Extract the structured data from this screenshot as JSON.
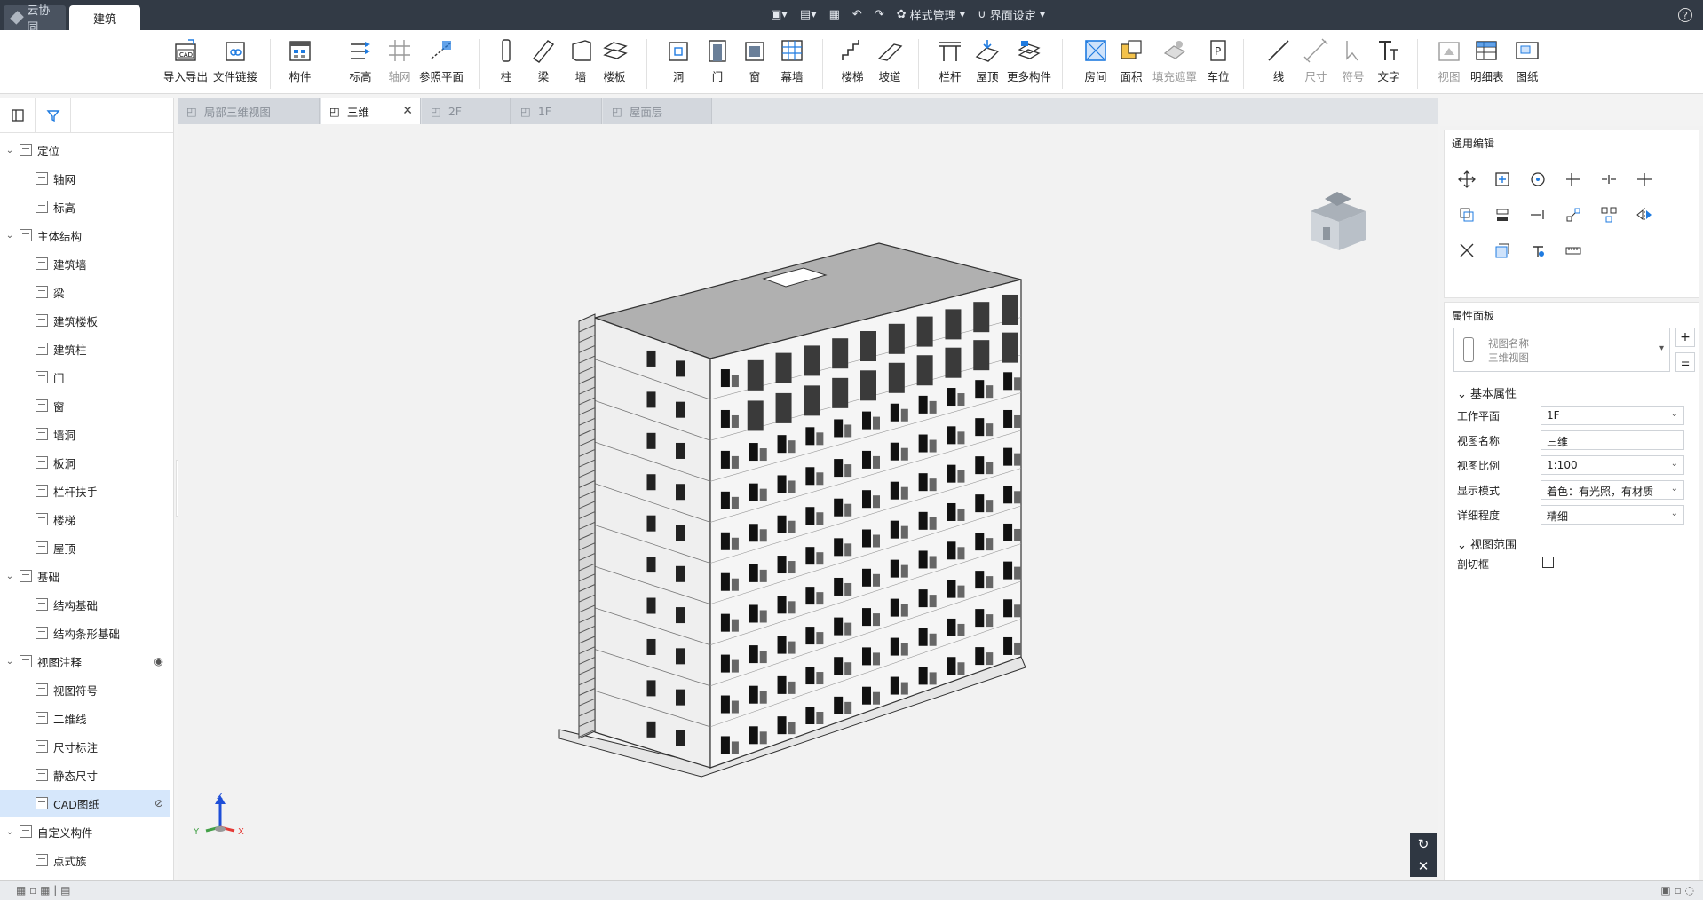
{
  "titlebar": {
    "app_tabs": [
      "云协同",
      "建筑"
    ],
    "quick_access": {
      "style_manage": "样式管理",
      "ui_settings": "界面设定"
    },
    "help": "?"
  },
  "ribbon": {
    "import_export": "导入导出",
    "file_link": "文件链接",
    "component": "构件",
    "level": "标高",
    "grid": "轴网",
    "ref_plane": "参照平面",
    "column": "柱",
    "beam": "梁",
    "wall": "墙",
    "slab": "楼板",
    "hole": "洞",
    "door": "门",
    "window": "窗",
    "curtain_wall": "幕墙",
    "stair": "楼梯",
    "ramp": "坡道",
    "railing": "栏杆",
    "roof": "屋顶",
    "more_components": "更多构件",
    "room": "房间",
    "area": "面积",
    "fill_mask": "填充遮罩",
    "parking": "车位",
    "line": "线",
    "dimension": "尺寸",
    "symbol": "符号",
    "text": "文字",
    "view": "视图",
    "schedule": "明细表",
    "drawing": "图纸",
    "cad_badge": "CAD"
  },
  "tree": [
    {
      "label": "定位",
      "level": 0
    },
    {
      "label": "轴网",
      "level": 1
    },
    {
      "label": "标高",
      "level": 1
    },
    {
      "label": "主体结构",
      "level": 0
    },
    {
      "label": "建筑墙",
      "level": 1
    },
    {
      "label": "梁",
      "level": 1
    },
    {
      "label": "建筑楼板",
      "level": 1
    },
    {
      "label": "建筑柱",
      "level": 1
    },
    {
      "label": "门",
      "level": 1
    },
    {
      "label": "窗",
      "level": 1
    },
    {
      "label": "墙洞",
      "level": 1
    },
    {
      "label": "板洞",
      "level": 1
    },
    {
      "label": "栏杆扶手",
      "level": 1
    },
    {
      "label": "楼梯",
      "level": 1
    },
    {
      "label": "屋顶",
      "level": 1
    },
    {
      "label": "基础",
      "level": 0
    },
    {
      "label": "结构基础",
      "level": 1
    },
    {
      "label": "结构条形基础",
      "level": 1
    },
    {
      "label": "视图注释",
      "level": 0
    },
    {
      "label": "视图符号",
      "level": 1
    },
    {
      "label": "二维线",
      "level": 1
    },
    {
      "label": "尺寸标注",
      "level": 1
    },
    {
      "label": "静态尺寸",
      "level": 1
    },
    {
      "label": "CAD图纸",
      "level": 1
    },
    {
      "label": "自定义构件",
      "level": 0
    },
    {
      "label": "点式族",
      "level": 1
    }
  ],
  "doc_tabs": [
    "局部三维视图",
    "三维",
    "2F",
    "1F",
    "屋面层"
  ],
  "right_panel": {
    "general_edit": "通用编辑",
    "property_panel": "属性面板",
    "view_name_caption": "视图名称",
    "view_name_value": "三维视图",
    "basic_props": "基本属性",
    "props": [
      {
        "label": "工作平面",
        "value": "1F"
      },
      {
        "label": "视图名称",
        "value": "三维"
      },
      {
        "label": "视图比例",
        "value": "1:100"
      },
      {
        "label": "显示模式",
        "value": "着色：有光照，有材质"
      },
      {
        "label": "详细程度",
        "value": "精细"
      }
    ],
    "view_range": "视图范围",
    "section_box": "剖切框"
  },
  "axes": {
    "x": "X",
    "y": "Y",
    "z": "Z"
  },
  "colors": {
    "titlebar": "#323a45",
    "accent": "#1f7be0",
    "axis_x": "#e53935",
    "axis_y": "#43a047",
    "axis_z": "#1e4fd8"
  }
}
